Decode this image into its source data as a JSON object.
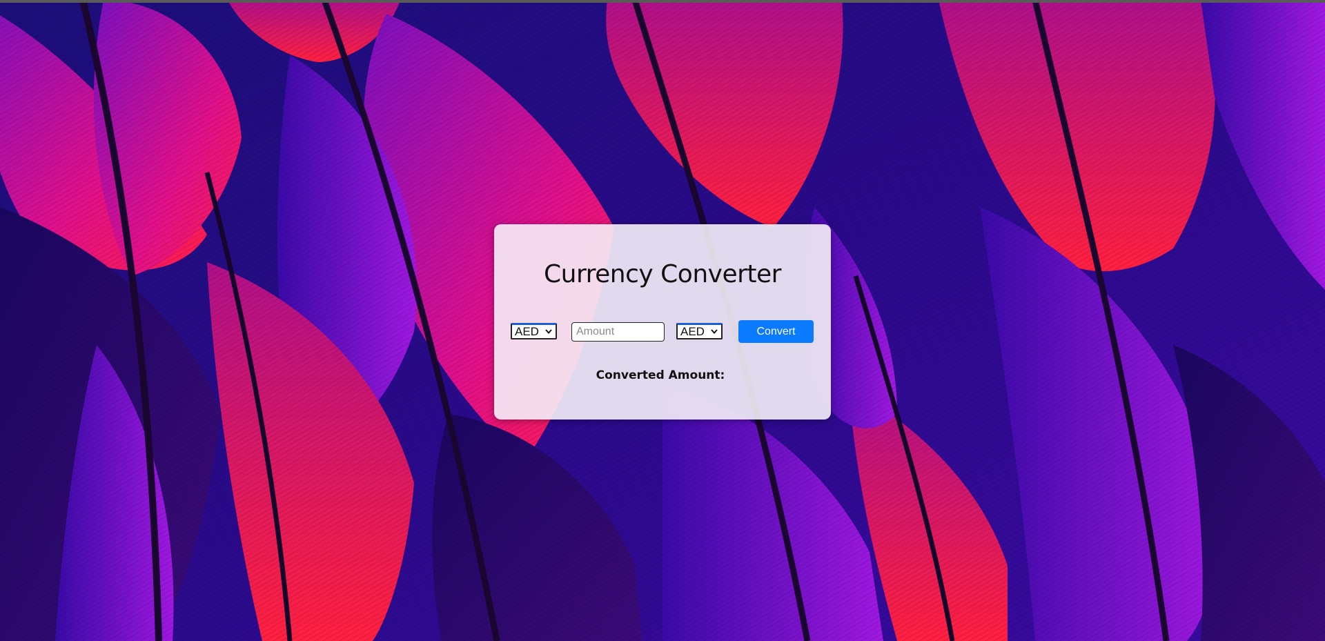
{
  "converter": {
    "title": "Currency Converter",
    "from_currency": "AED",
    "to_currency": "AED",
    "amount_placeholder": "Amount",
    "amount_value": "",
    "convert_label": "Convert",
    "result_label": "Converted Amount:",
    "result_value": ""
  },
  "colors": {
    "button": "#0a7bff",
    "select_focus_top": "#1a5fd6"
  },
  "icons": {
    "select_arrow": "chevron-down-icon"
  }
}
